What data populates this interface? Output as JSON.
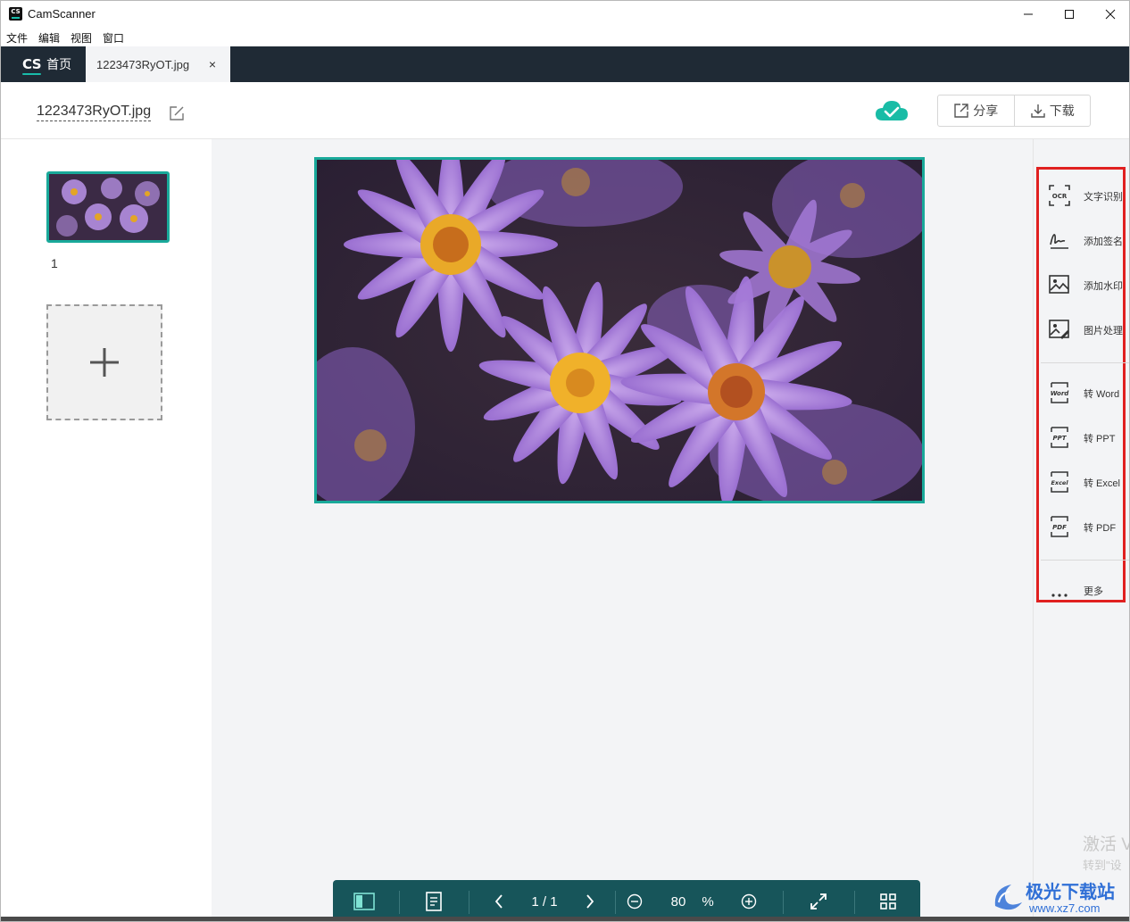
{
  "window": {
    "title": "CamScanner",
    "logo_text": "CS"
  },
  "menu": [
    "文件",
    "编辑",
    "视图",
    "窗口"
  ],
  "tabs": {
    "home_mark": "CS",
    "home_label": "首页",
    "file_label": "1223473RyOT.jpg",
    "close_glyph": "×"
  },
  "document": {
    "name": "1223473RyOT.jpg",
    "share_label": "分享",
    "download_label": "下载"
  },
  "thumbnails": {
    "page_number": "1"
  },
  "tools": {
    "ocr": "文字识别",
    "signature": "添加签名",
    "watermark": "添加水印",
    "image_process": "图片处理",
    "to_word": "转 Word",
    "to_ppt": "转 PPT",
    "to_excel": "转 Excel",
    "to_pdf": "转 PDF",
    "more": "更多",
    "ocr_icon_text": "OCR",
    "word_icon_text": "Word",
    "ppt_icon_text": "PPT",
    "excel_icon_text": "Excel",
    "pdf_icon_text": "PDF"
  },
  "bottombar": {
    "page_indicator": "1 / 1",
    "zoom_value": "80",
    "zoom_unit": "%"
  },
  "overlay": {
    "activate_line1": "激活 V",
    "activate_line2": "转到\"设",
    "site_name": "极光下载站",
    "site_url": "www.xz7.com"
  },
  "colors": {
    "accent": "#19a99a",
    "tabbar": "#1f2a35",
    "toolbar": "#17555a",
    "highlight": "#e02020"
  }
}
